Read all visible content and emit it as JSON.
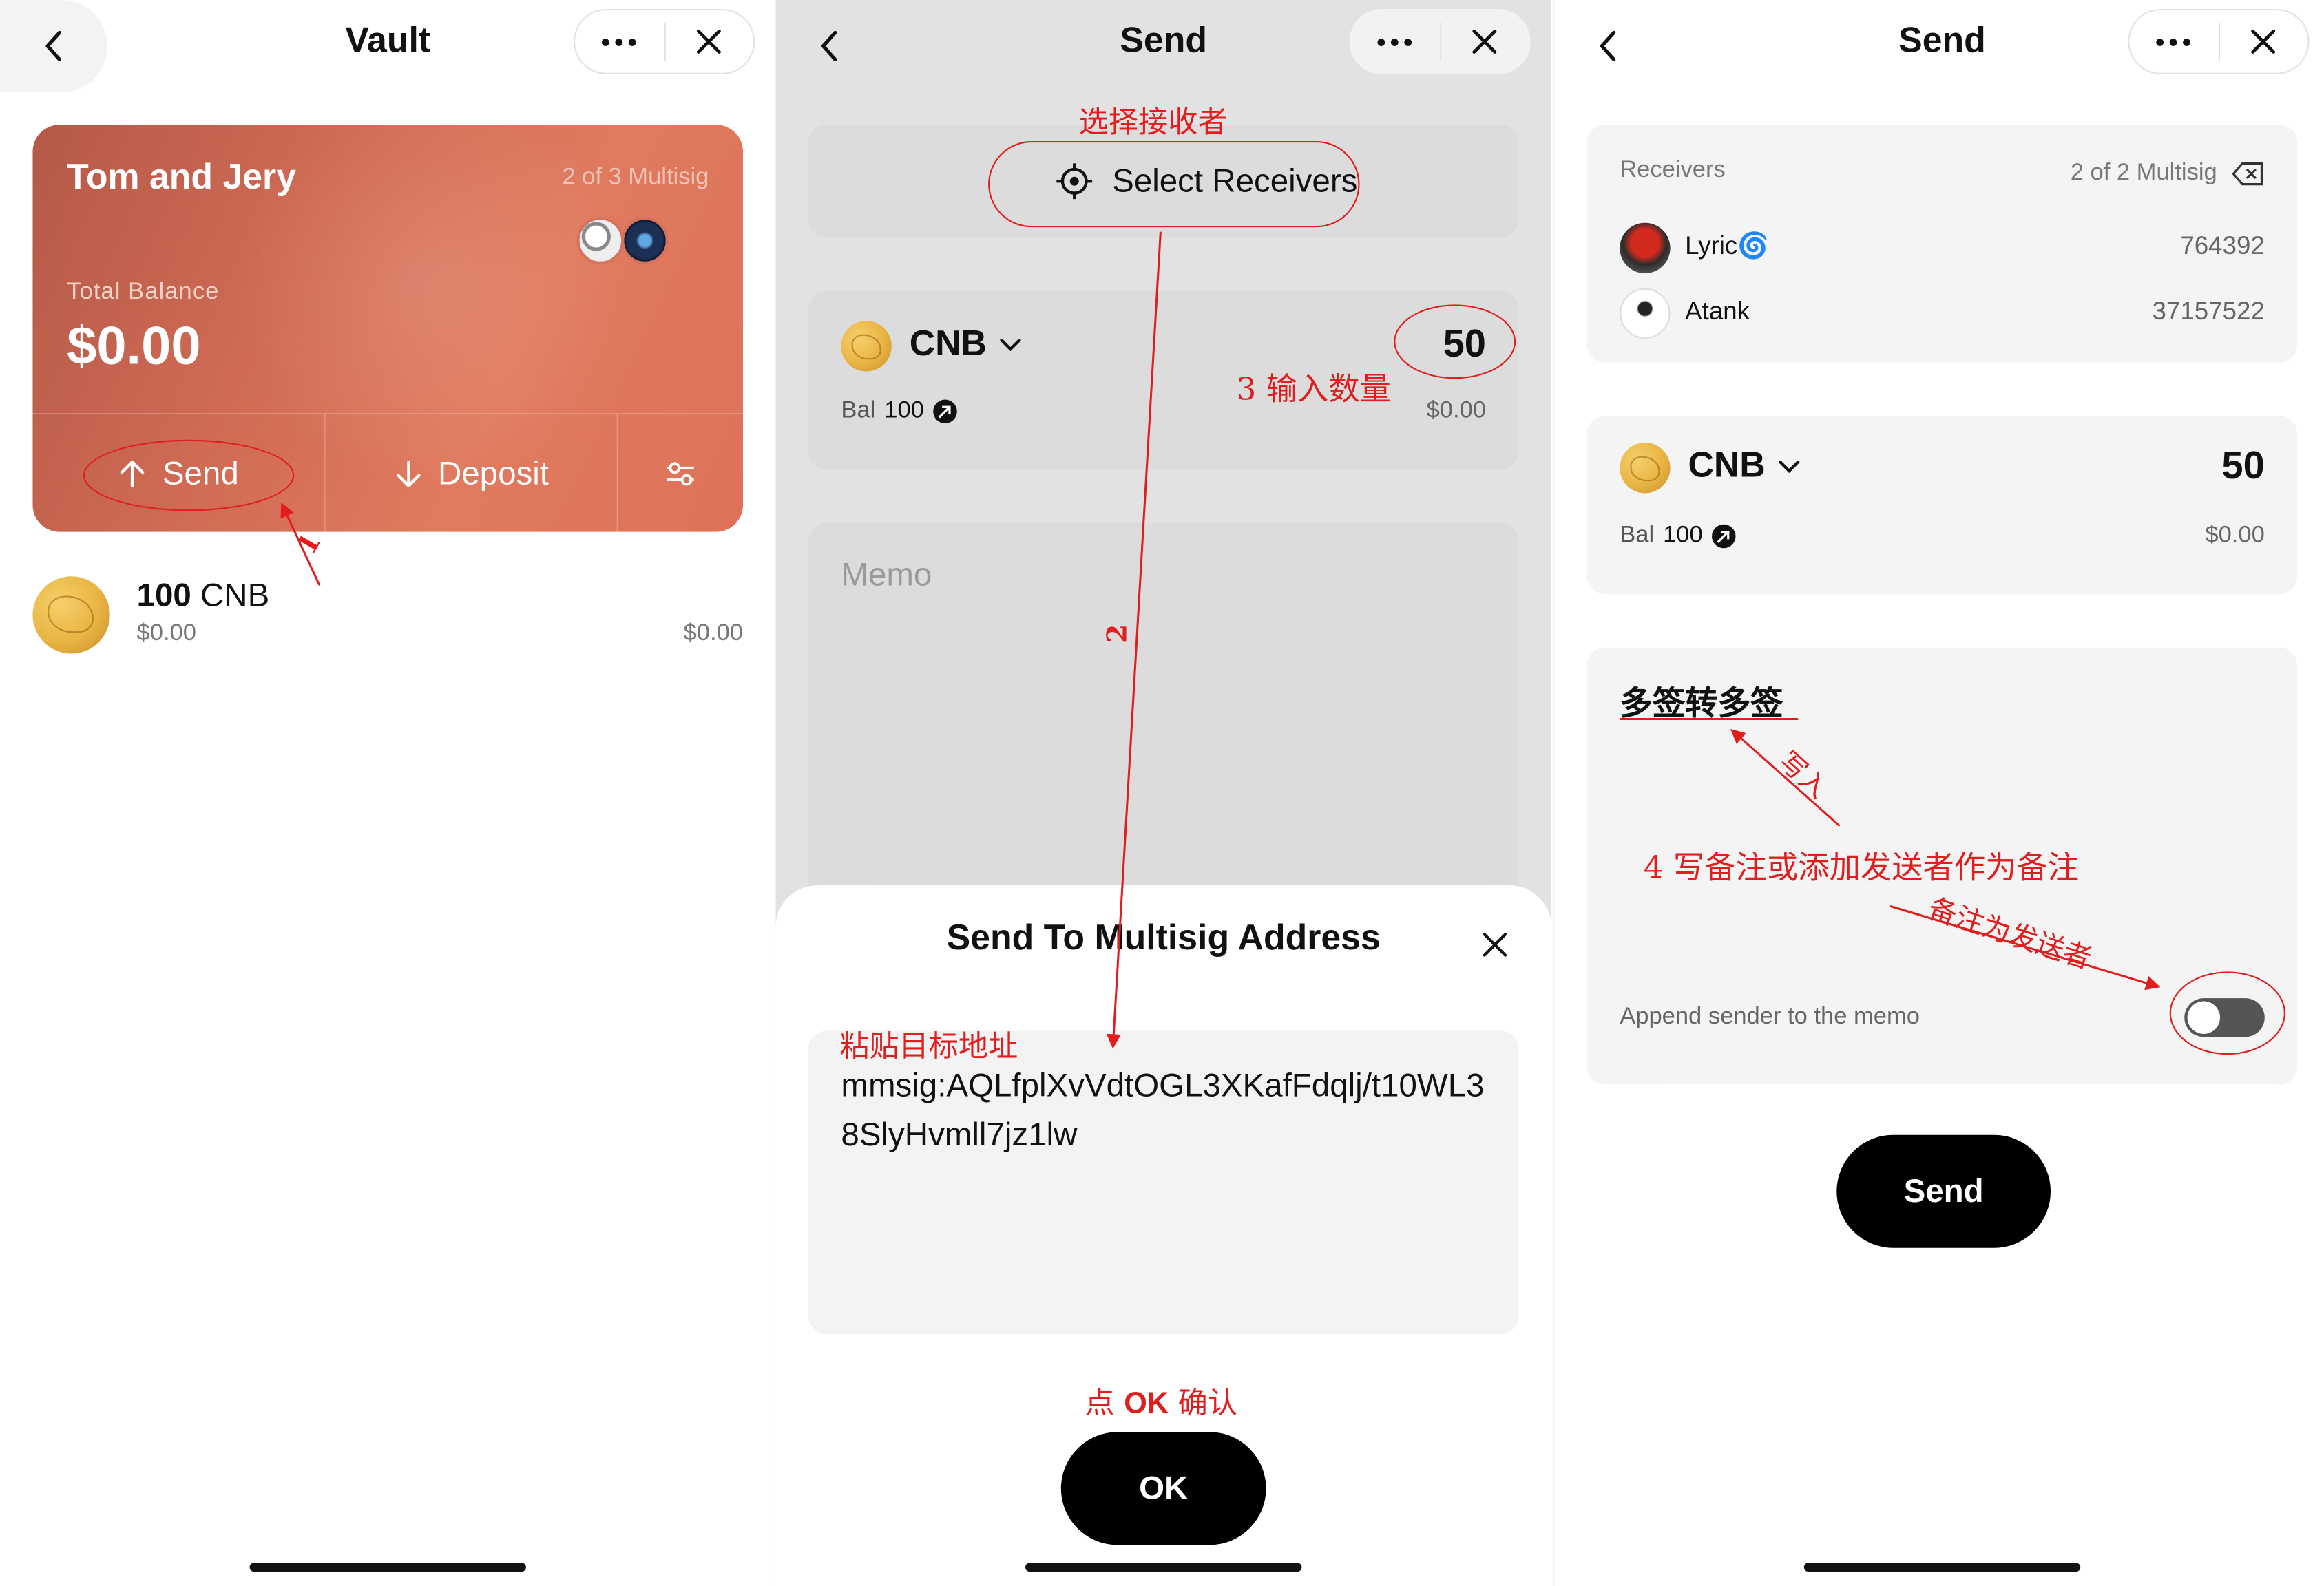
{
  "panel1": {
    "title": "Vault",
    "vault": {
      "name": "Tom and Jery",
      "multisig": "2 of 3 Multisig",
      "total_label": "Total Balance",
      "balance": "$0.00",
      "send_label": "Send",
      "deposit_label": "Deposit"
    },
    "asset": {
      "amount": "100",
      "symbol": "CNB",
      "fiat_left": "$0.00",
      "fiat_right": "$0.00"
    }
  },
  "panel2": {
    "title": "Send",
    "select_receivers": "Select Receivers",
    "token": "CNB",
    "amount": "50",
    "bal_label": "Bal",
    "bal_value": "100",
    "fiat": "$0.00",
    "memo_placeholder": "Memo",
    "sheet": {
      "title": "Send To Multisig Address",
      "address": "mmsig:AQLfplXvVdtOGL3XKafFdqlj/t10WL38SlyHvmll7jz1lw",
      "ok_label": "OK"
    }
  },
  "panel3": {
    "title": "Send",
    "receivers_label": "Receivers",
    "multisig": "2 of 2 Multisig",
    "receivers": [
      {
        "name": "Lyric🌀",
        "id": "764392"
      },
      {
        "name": "Atank",
        "id": "37157522"
      }
    ],
    "token": "CNB",
    "amount": "50",
    "bal_label": "Bal",
    "bal_value": "100",
    "fiat": "$0.00",
    "memo_text": "多签转多签",
    "append_label": "Append sender to the memo",
    "send_label": "Send"
  },
  "annotations": {
    "n1": "1",
    "n2": "2",
    "select_receiver": "选择接收者",
    "enter_amount": "3 输入数量",
    "paste_address": "粘贴目标地址",
    "click_ok_pre": "点 ",
    "click_ok_bold": "OK",
    "click_ok_post": " 确认",
    "write_in": "写入",
    "step4": "4 写备注或添加发送者作为备注",
    "memo_sender": "备注为发送者"
  },
  "colors": {
    "accent_red": "#e11d1d",
    "card_gradient_start": "#b45a48",
    "card_gradient_end": "#e07a5e"
  }
}
